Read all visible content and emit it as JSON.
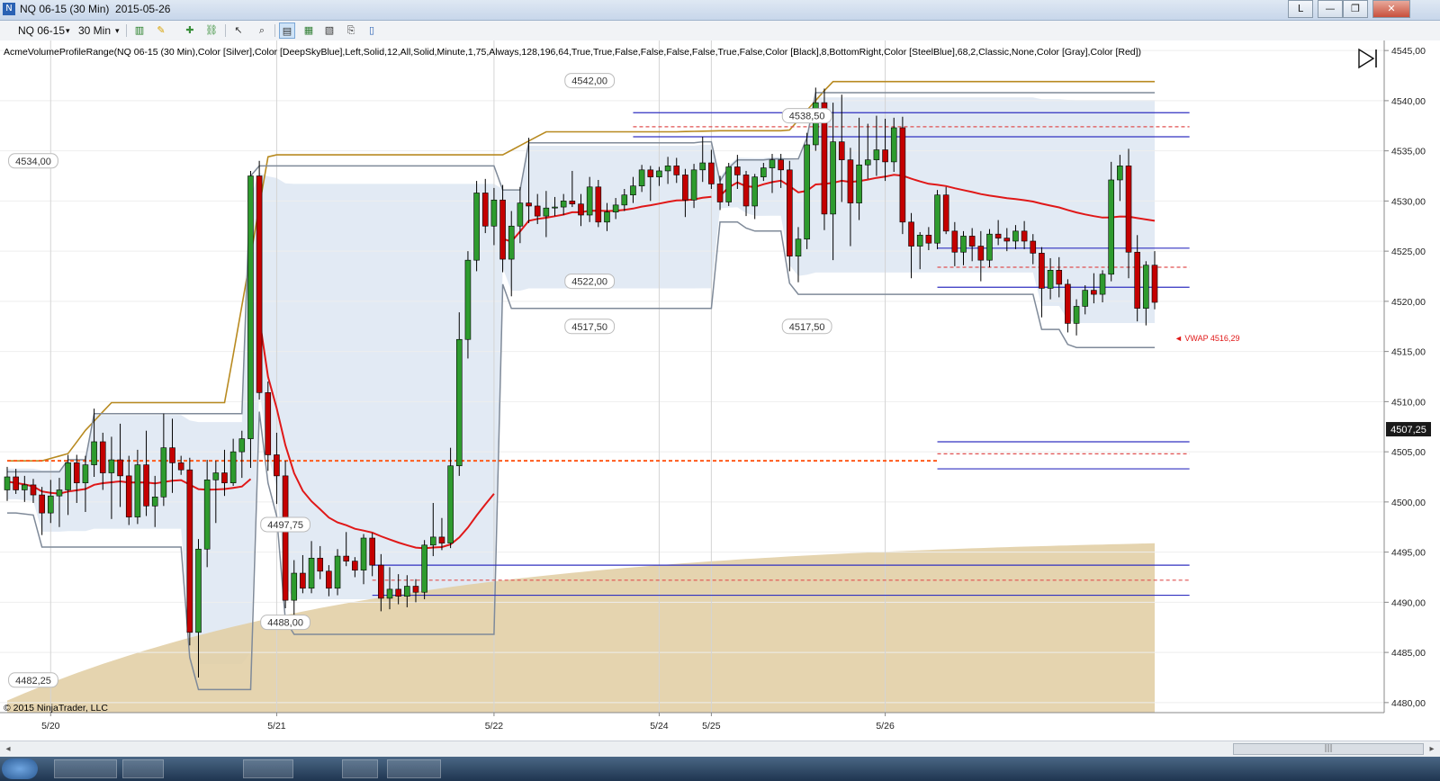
{
  "window": {
    "title": "NQ 06-15 (30 Min)  2015-05-26",
    "buttons": {
      "help": "L",
      "minimize": "—",
      "restore": "❐",
      "close": "✕"
    }
  },
  "toolbar": {
    "instrument": "NQ 06-15",
    "interval": "30 Min",
    "dropdown_glyph": "▾",
    "icons": [
      "bar-chart-icon",
      "draw-pencil-icon",
      "draw-tools-icon",
      "link-icon",
      "arrow-cursor-icon",
      "zoom-icon",
      "chart-style-icon",
      "indicators-icon",
      "strategy-icon",
      "copy-icon",
      "data-box-icon"
    ]
  },
  "chart_data": {
    "type": "candlestick",
    "title": "AcmeVolumeProfileRange(NQ 06-15 (30 Min),Color [Silver],Color [DeepSkyBlue],Left,Solid,12,All,Solid,Minute,1,75,Always,128,196,64,True,True,False,False,False,False,True,False,Color [Black],8,BottomRight,Color [SteelBlue],68,2,Classic,None,Color [Gray],Color [Red])",
    "copyright": "© 2015 NinjaTrader, LLC",
    "colors": {
      "up": "#2e9b2e",
      "down": "#c40000",
      "vwap": "#e01818",
      "va_band": "#dde6f2",
      "volume_area": "#e2cfa6",
      "upper_line": "#b88a20",
      "gray_line": "#7f8a99",
      "level_line": "#3030c0"
    },
    "y_axis": {
      "min": 4479,
      "max": 4546,
      "ticks": [
        4480,
        4485,
        4490,
        4495,
        4500,
        4505,
        4510,
        4515,
        4520,
        4525,
        4530,
        4535,
        4540,
        4545
      ],
      "tick_labels": [
        "4480,00",
        "4485,00",
        "4490,00",
        "4495,00",
        "4500,00",
        "4505,00",
        "4510,00",
        "4515,00",
        "4520,00",
        "4525,00",
        "4530,00",
        "4535,00",
        "4540,00",
        "4545,00"
      ]
    },
    "x_axis": {
      "dates": [
        "5/20",
        "5/21",
        "5/22",
        "5/24",
        "5/25",
        "5/26"
      ],
      "date_bar_index": [
        5,
        31,
        56,
        75,
        81,
        101
      ]
    },
    "last_price": {
      "label": "4507,25",
      "value": 4507.25
    },
    "vwap": {
      "label": "◄ VWAP  4516,29",
      "value": 4516.29
    },
    "price_labels": [
      {
        "text": "4534,00",
        "bar": 3,
        "value": 4534.0
      },
      {
        "text": "4482,25",
        "bar": 3,
        "value": 4482.25
      },
      {
        "text": "4497,75",
        "bar": 32,
        "value": 4497.75
      },
      {
        "text": "4488,00",
        "bar": 32,
        "value": 4488.0
      },
      {
        "text": "4542,00",
        "bar": 67,
        "value": 4542.0
      },
      {
        "text": "4522,00",
        "bar": 67,
        "value": 4522.0
      },
      {
        "text": "4517,50",
        "bar": 67,
        "value": 4517.5
      },
      {
        "text": "4538,50",
        "bar": 92,
        "value": 4538.5
      },
      {
        "text": "4517,50",
        "bar": 92,
        "value": 4517.5
      }
    ],
    "level_lines": [
      {
        "value": 4538.8,
        "from_bar": 72,
        "to_bar": 136,
        "style": "solid",
        "color": "#3030c0"
      },
      {
        "value": 4537.4,
        "from_bar": 72,
        "to_bar": 136,
        "style": "dashed",
        "color": "#e05050"
      },
      {
        "value": 4536.4,
        "from_bar": 72,
        "to_bar": 136,
        "style": "solid",
        "color": "#3030c0"
      },
      {
        "value": 4525.3,
        "from_bar": 107,
        "to_bar": 136,
        "style": "solid",
        "color": "#3030c0"
      },
      {
        "value": 4523.4,
        "from_bar": 107,
        "to_bar": 136,
        "style": "dashed",
        "color": "#e05050"
      },
      {
        "value": 4521.4,
        "from_bar": 107,
        "to_bar": 136,
        "style": "solid",
        "color": "#3030c0"
      },
      {
        "value": 4506.0,
        "from_bar": 107,
        "to_bar": 136,
        "style": "solid",
        "color": "#3030c0"
      },
      {
        "value": 4504.8,
        "from_bar": 107,
        "to_bar": 136,
        "style": "dashed",
        "color": "#e05050"
      },
      {
        "value": 4503.3,
        "from_bar": 107,
        "to_bar": 136,
        "style": "solid",
        "color": "#3030c0"
      },
      {
        "value": 4493.7,
        "from_bar": 42,
        "to_bar": 136,
        "style": "solid",
        "color": "#3030c0"
      },
      {
        "value": 4492.2,
        "from_bar": 42,
        "to_bar": 136,
        "style": "dashed",
        "color": "#e05050"
      },
      {
        "value": 4490.7,
        "from_bar": 42,
        "to_bar": 136,
        "style": "solid",
        "color": "#3030c0"
      },
      {
        "value": 4504.1,
        "from_bar": 0,
        "to_bar": 107,
        "style": "dashed",
        "color": "#ff5a1a"
      }
    ],
    "candles": [
      [
        4501.2,
        4503.5,
        4500.1,
        4502.5
      ],
      [
        4502.5,
        4503.3,
        4500.8,
        4501.2
      ],
      [
        4501.2,
        4502.6,
        4500.0,
        4501.7
      ],
      [
        4501.7,
        4502.3,
        4499.9,
        4500.7
      ],
      [
        4500.7,
        4501.5,
        4496.7,
        4498.9
      ],
      [
        4498.9,
        4502.2,
        4497.9,
        4500.6
      ],
      [
        4500.6,
        4502.4,
        4497.5,
        4501.2
      ],
      [
        4501.2,
        4504.7,
        4498.7,
        4503.9
      ],
      [
        4503.9,
        4504.7,
        4499.9,
        4501.9
      ],
      [
        4501.9,
        4504.6,
        4499.0,
        4503.7
      ],
      [
        4503.7,
        4509.3,
        4502.5,
        4506.0
      ],
      [
        4506.0,
        4506.9,
        4501.2,
        4502.9
      ],
      [
        4502.9,
        4506.5,
        4498.3,
        4504.2
      ],
      [
        4504.2,
        4507.8,
        4499.5,
        4502.6
      ],
      [
        4502.6,
        4504.6,
        4497.7,
        4498.5
      ],
      [
        4498.5,
        4505.2,
        4497.8,
        4503.7
      ],
      [
        4503.7,
        4507.1,
        4498.6,
        4499.6
      ],
      [
        4499.6,
        4502.6,
        4497.5,
        4500.5
      ],
      [
        4500.5,
        4508.8,
        4499.6,
        4505.4
      ],
      [
        4505.4,
        4508.3,
        4500.9,
        4503.9
      ],
      [
        4503.9,
        4504.6,
        4502.7,
        4503.2
      ],
      [
        4503.2,
        4504.4,
        4485.7,
        4487.0
      ],
      [
        4487.0,
        4496.3,
        4482.5,
        4495.3
      ],
      [
        4495.3,
        4504.2,
        4493.5,
        4502.2
      ],
      [
        4502.2,
        4504.1,
        4497.9,
        4502.9
      ],
      [
        4502.9,
        4505.2,
        4500.6,
        4501.9
      ],
      [
        4501.9,
        4506.3,
        4501.6,
        4505.0
      ],
      [
        4505.0,
        4507.1,
        4502.4,
        4506.3
      ],
      [
        4506.3,
        4533.0,
        4503.4,
        4532.5
      ],
      [
        4532.5,
        4534.0,
        4510.2,
        4510.9
      ],
      [
        4510.9,
        4512.0,
        4503.1,
        4504.7
      ],
      [
        4504.7,
        4506.9,
        4499.8,
        4502.6
      ],
      [
        4502.6,
        4504.1,
        4489.4,
        4490.2
      ],
      [
        4490.2,
        4494.2,
        4488.0,
        4492.9
      ],
      [
        4492.9,
        4494.7,
        4490.9,
        4491.4
      ],
      [
        4491.4,
        4496.1,
        4490.9,
        4494.4
      ],
      [
        4494.4,
        4495.6,
        4492.3,
        4493.1
      ],
      [
        4493.1,
        4493.7,
        4490.6,
        4491.4
      ],
      [
        4491.4,
        4495.3,
        4490.7,
        4494.6
      ],
      [
        4494.6,
        4497.0,
        4493.6,
        4494.1
      ],
      [
        4494.1,
        4494.5,
        4492.5,
        4493.2
      ],
      [
        4493.2,
        4496.8,
        4491.8,
        4496.4
      ],
      [
        4496.4,
        4496.9,
        4492.6,
        4493.7
      ],
      [
        4493.7,
        4494.8,
        4489.1,
        4490.4
      ],
      [
        4490.4,
        4493.5,
        4489.3,
        4491.3
      ],
      [
        4491.3,
        4492.8,
        4489.8,
        4490.6
      ],
      [
        4490.6,
        4492.7,
        4489.5,
        4491.6
      ],
      [
        4491.6,
        4492.3,
        4490.0,
        4491.0
      ],
      [
        4491.0,
        4496.2,
        4490.3,
        4495.7
      ],
      [
        4495.7,
        4499.9,
        4494.6,
        4496.5
      ],
      [
        4496.5,
        4498.4,
        4495.2,
        4495.9
      ],
      [
        4495.9,
        4505.4,
        4495.4,
        4503.6
      ],
      [
        4503.6,
        4518.9,
        4502.6,
        4516.2
      ],
      [
        4516.2,
        4525.0,
        4514.3,
        4524.1
      ],
      [
        4524.1,
        4532.0,
        4523.0,
        4530.8
      ],
      [
        4530.8,
        4532.2,
        4526.8,
        4527.5
      ],
      [
        4527.5,
        4531.3,
        4525.6,
        4530.1
      ],
      [
        4530.1,
        4531.6,
        4522.9,
        4524.2
      ],
      [
        4524.2,
        4529.0,
        4520.5,
        4527.5
      ],
      [
        4527.5,
        4531.4,
        4525.8,
        4529.8
      ],
      [
        4529.8,
        4536.3,
        4527.8,
        4529.5
      ],
      [
        4529.5,
        4530.7,
        4527.7,
        4528.5
      ],
      [
        4528.5,
        4531.0,
        4526.4,
        4529.3
      ],
      [
        4529.3,
        4530.4,
        4528.5,
        4529.4
      ],
      [
        4529.4,
        4530.7,
        4528.6,
        4530.0
      ],
      [
        4530.0,
        4533.0,
        4529.4,
        4529.7
      ],
      [
        4529.7,
        4530.7,
        4527.5,
        4528.6
      ],
      [
        4528.6,
        4532.4,
        4527.9,
        4531.4
      ],
      [
        4531.4,
        4532.1,
        4527.4,
        4527.9
      ],
      [
        4527.9,
        4529.8,
        4527.0,
        4528.9
      ],
      [
        4528.9,
        4530.3,
        4528.2,
        4529.6
      ],
      [
        4529.6,
        4531.2,
        4529.0,
        4530.6
      ],
      [
        4530.6,
        4532.4,
        4529.8,
        4531.5
      ],
      [
        4531.5,
        4533.6,
        4530.9,
        4533.1
      ],
      [
        4533.1,
        4533.5,
        4530.0,
        4532.4
      ],
      [
        4532.4,
        4533.4,
        4531.5,
        4533.0
      ],
      [
        4533.0,
        4534.4,
        4531.7,
        4533.5
      ],
      [
        4533.5,
        4534.3,
        4531.8,
        4532.6
      ],
      [
        4532.6,
        4533.2,
        4528.4,
        4530.1
      ],
      [
        4530.1,
        4533.7,
        4529.3,
        4533.1
      ],
      [
        4533.1,
        4536.4,
        4531.9,
        4533.8
      ],
      [
        4533.8,
        4535.1,
        4531.2,
        4531.7
      ],
      [
        4531.7,
        4532.5,
        4529.1,
        4529.9
      ],
      [
        4529.9,
        4533.8,
        4529.5,
        4533.4
      ],
      [
        4533.4,
        4534.6,
        4531.2,
        4532.6
      ],
      [
        4532.6,
        4533.0,
        4528.5,
        4529.5
      ],
      [
        4529.5,
        4532.7,
        4528.2,
        4532.4
      ],
      [
        4532.4,
        4533.8,
        4532.0,
        4533.3
      ],
      [
        4533.3,
        4534.7,
        4530.8,
        4534.1
      ],
      [
        4534.1,
        4534.7,
        4531.3,
        4533.1
      ],
      [
        4533.1,
        4534.0,
        4523.0,
        4524.5
      ],
      [
        4524.5,
        4527.4,
        4521.9,
        4526.2
      ],
      [
        4526.2,
        4536.8,
        4525.2,
        4535.6
      ],
      [
        4535.6,
        4541.3,
        4535.0,
        4539.8
      ],
      [
        4539.8,
        4541.2,
        4527.1,
        4528.7
      ],
      [
        4528.7,
        4539.8,
        4524.1,
        4535.9
      ],
      [
        4535.9,
        4540.6,
        4529.9,
        4534.1
      ],
      [
        4534.1,
        4535.3,
        4525.5,
        4529.8
      ],
      [
        4529.8,
        4538.3,
        4528.1,
        4533.6
      ],
      [
        4533.6,
        4537.7,
        4532.2,
        4534.1
      ],
      [
        4534.1,
        4538.5,
        4532.5,
        4535.1
      ],
      [
        4535.1,
        4538.2,
        4532.0,
        4533.9
      ],
      [
        4533.9,
        4538.3,
        4532.9,
        4537.3
      ],
      [
        4537.3,
        4538.4,
        4526.7,
        4527.9
      ],
      [
        4527.9,
        4528.8,
        4522.3,
        4525.5
      ],
      [
        4525.5,
        4526.9,
        4523.2,
        4526.6
      ],
      [
        4526.6,
        4527.4,
        4525.1,
        4525.8
      ],
      [
        4525.8,
        4531.1,
        4525.2,
        4530.6
      ],
      [
        4530.6,
        4531.4,
        4526.7,
        4527.0
      ],
      [
        4527.0,
        4527.9,
        4523.5,
        4524.9
      ],
      [
        4524.9,
        4527.0,
        4523.6,
        4526.5
      ],
      [
        4526.5,
        4527.3,
        4524.0,
        4525.5
      ],
      [
        4525.5,
        4527.0,
        4522.0,
        4524.1
      ],
      [
        4524.1,
        4527.2,
        4523.4,
        4526.7
      ],
      [
        4526.7,
        4528.1,
        4525.6,
        4526.3
      ],
      [
        4526.3,
        4527.3,
        4525.0,
        4526.0
      ],
      [
        4526.0,
        4527.6,
        4525.2,
        4527.0
      ],
      [
        4527.0,
        4528.0,
        4525.2,
        4526.0
      ],
      [
        4526.0,
        4526.7,
        4523.7,
        4524.8
      ],
      [
        4524.8,
        4525.4,
        4518.4,
        4521.3
      ],
      [
        4521.3,
        4524.3,
        4520.2,
        4523.1
      ],
      [
        4523.1,
        4524.4,
        4520.4,
        4521.7
      ],
      [
        4521.7,
        4522.2,
        4516.9,
        4517.8
      ],
      [
        4517.8,
        4520.2,
        4516.6,
        4519.5
      ],
      [
        4519.5,
        4521.6,
        4518.7,
        4521.1
      ],
      [
        4521.1,
        4522.8,
        4519.8,
        4520.7
      ],
      [
        4520.7,
        4523.1,
        4519.9,
        4522.7
      ],
      [
        4522.7,
        4533.9,
        4522.0,
        4532.1
      ],
      [
        4532.1,
        4534.6,
        4530.0,
        4533.5
      ],
      [
        4533.5,
        4535.2,
        4522.3,
        4524.9
      ],
      [
        4524.9,
        4526.6,
        4518.0,
        4519.3
      ],
      [
        4519.3,
        4524.0,
        4517.6,
        4523.6
      ],
      [
        4523.6,
        4525.0,
        4519.2,
        4519.9
      ]
    ]
  }
}
